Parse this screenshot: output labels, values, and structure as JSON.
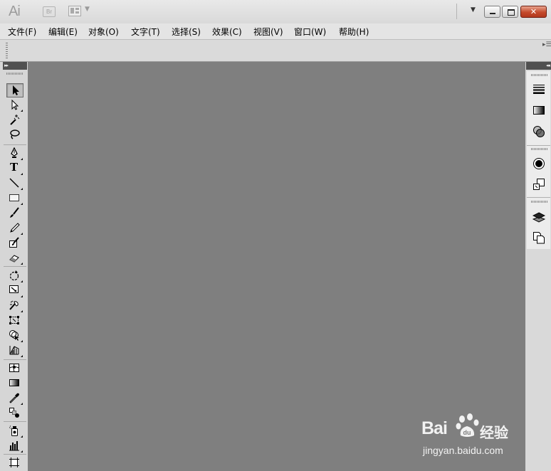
{
  "app": {
    "logo_text": "Ai",
    "bridge_label": "Br"
  },
  "menubar": {
    "items": [
      {
        "label": "文件(F)"
      },
      {
        "label": "编辑(E)"
      },
      {
        "label": "对象(O)"
      },
      {
        "label": "文字(T)"
      },
      {
        "label": "选择(S)"
      },
      {
        "label": "效果(C)"
      },
      {
        "label": "视图(V)"
      },
      {
        "label": "窗口(W)"
      },
      {
        "label": "帮助(H)"
      }
    ]
  },
  "window_controls": {
    "minimize_icon": "minimize-icon",
    "restore_icon": "restore-icon",
    "close_glyph": "✕"
  },
  "toolbar_header": {
    "collapse_glyph": "▸▸"
  },
  "dock_header": {
    "collapse_glyph": "◂◂"
  },
  "tools": [
    {
      "name": "selection-tool",
      "selected": true
    },
    {
      "name": "direct-selection-tool"
    },
    {
      "name": "magic-wand-tool"
    },
    {
      "name": "lasso-tool"
    },
    {
      "name": "pen-tool"
    },
    {
      "name": "type-tool",
      "glyph": "T"
    },
    {
      "name": "line-segment-tool"
    },
    {
      "name": "rectangle-tool"
    },
    {
      "name": "paintbrush-tool"
    },
    {
      "name": "pencil-tool"
    },
    {
      "name": "blob-brush-tool"
    },
    {
      "name": "eraser-tool"
    },
    {
      "name": "rotate-tool"
    },
    {
      "name": "scale-tool"
    },
    {
      "name": "warp-tool"
    },
    {
      "name": "free-transform-tool"
    },
    {
      "name": "shape-builder-tool"
    },
    {
      "name": "perspective-grid-tool"
    },
    {
      "name": "mesh-tool"
    },
    {
      "name": "gradient-tool"
    },
    {
      "name": "eyedropper-tool"
    },
    {
      "name": "blend-tool"
    },
    {
      "name": "symbol-sprayer-tool"
    },
    {
      "name": "column-graph-tool"
    },
    {
      "name": "artboard-tool"
    }
  ],
  "dock_panels": [
    {
      "name": "stroke-panel-icon"
    },
    {
      "name": "gradient-panel-icon"
    },
    {
      "name": "transparency-panel-icon"
    },
    {
      "name": "appearance-panel-icon"
    },
    {
      "name": "graphic-styles-panel-icon"
    },
    {
      "name": "layers-panel-icon"
    },
    {
      "name": "artboards-panel-icon"
    }
  ],
  "watermark": {
    "brand": "Bai",
    "brand_suffix": "经验",
    "url": "jingyan.baidu.com"
  },
  "colors": {
    "canvas": "#7f7f7f",
    "panel": "#d6d6d6",
    "close_button": "#c44a2c"
  }
}
